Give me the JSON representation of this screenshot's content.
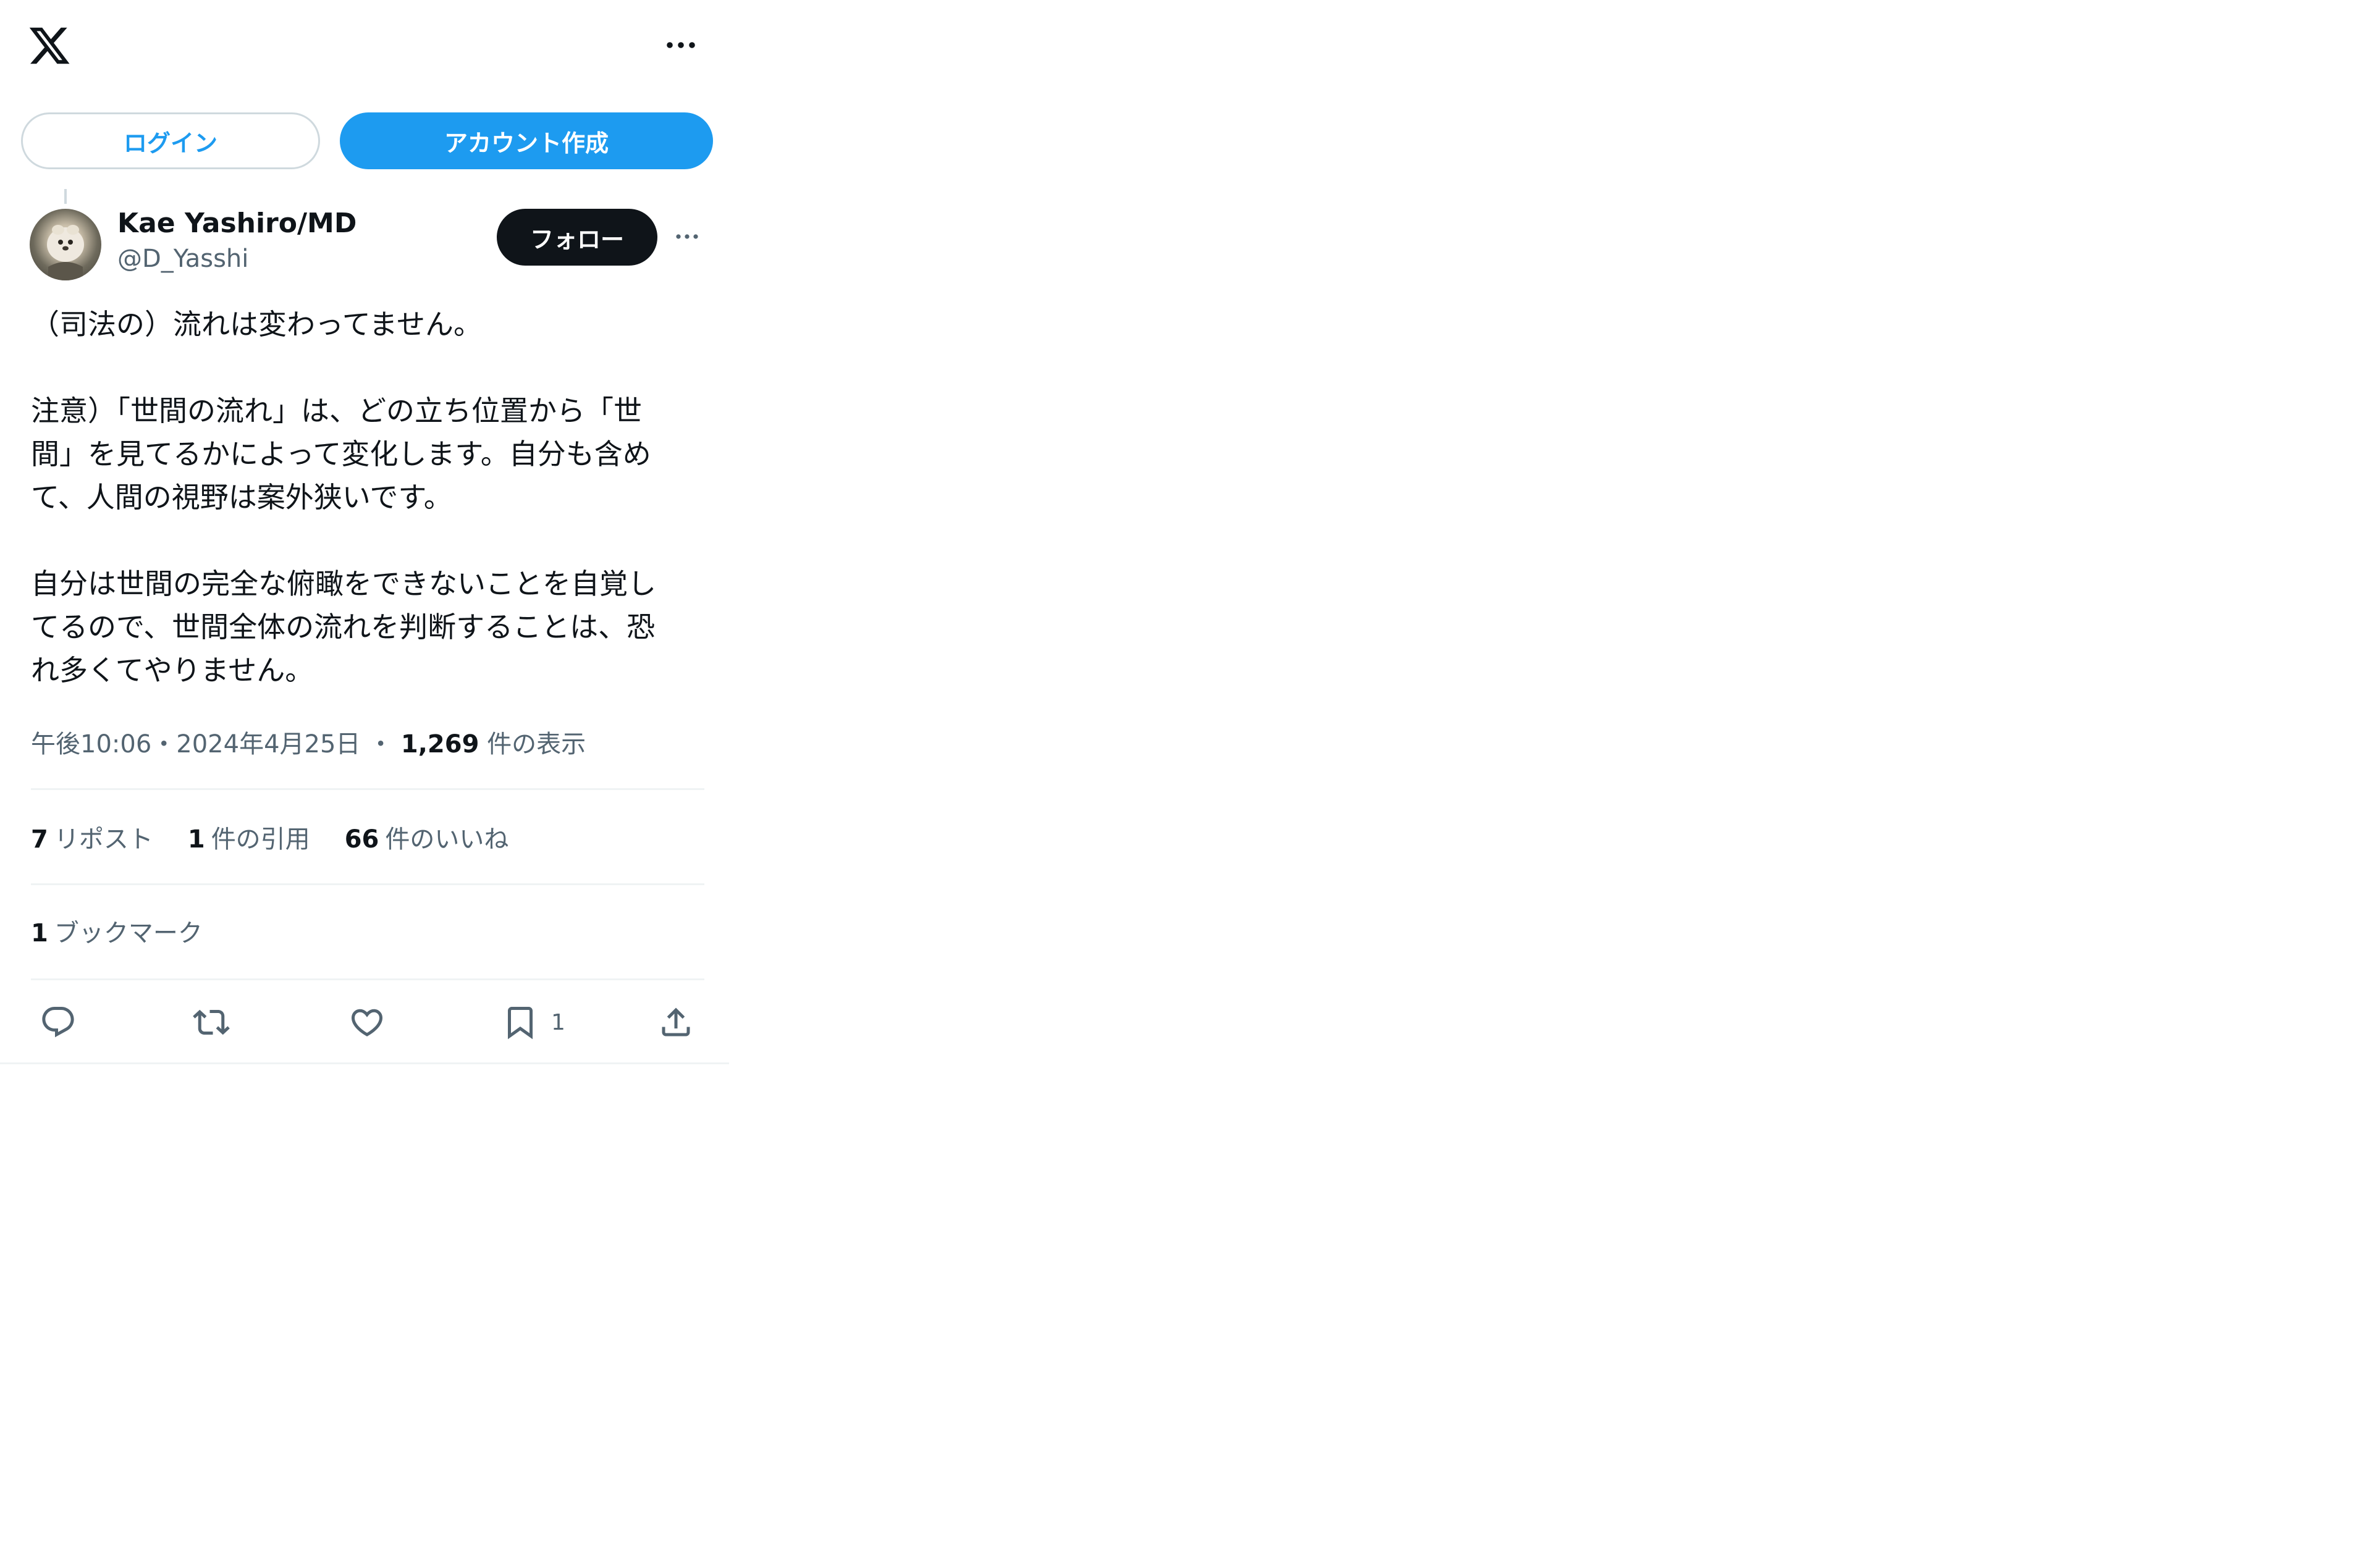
{
  "header": {
    "logo_icon": "x-logo-icon",
    "more_icon": "more-horizontal-icon"
  },
  "auth": {
    "login_label": "ログイン",
    "signup_label": "アカウント作成"
  },
  "author": {
    "name": "Kae Yashiro/MD",
    "handle": "@D_Yasshi",
    "follow_label": "フォロー",
    "avatar_icon": "avatar-image",
    "more_icon": "more-horizontal-icon"
  },
  "tweet": {
    "lines": [
      "（司法の）流れは変わってません。",
      "",
      "注意）「世間の流れ」は、どの立ち位置から「世",
      "間」を見てるかによって変化します。自分も含め",
      "て、人間の視野は案外狭いです。",
      "",
      "自分は世間の完全な俯瞰をできないことを自覚し",
      "てるので、世間全体の流れを判断することは、恐",
      "れ多くてやりません。"
    ]
  },
  "meta": {
    "time": "午後10:06",
    "date": "2024年4月25日",
    "separator": "・",
    "views_count": "1,269",
    "views_label": "件の表示"
  },
  "stats": {
    "reposts_count": "7",
    "reposts_label": "リポスト",
    "quotes_count": "1",
    "quotes_label": "件の引用",
    "likes_count": "66",
    "likes_label": "件のいいね",
    "bookmarks_count": "1",
    "bookmarks_label": "ブックマーク"
  },
  "actions": {
    "reply_icon": "reply-icon",
    "repost_icon": "repost-icon",
    "like_icon": "heart-icon",
    "bookmark_icon": "bookmark-icon",
    "bookmark_count": "1",
    "share_icon": "share-icon"
  },
  "colors": {
    "accent": "#1d9bf0",
    "text": "#0f1419",
    "secondary": "#536471",
    "border": "#eff3f4"
  }
}
